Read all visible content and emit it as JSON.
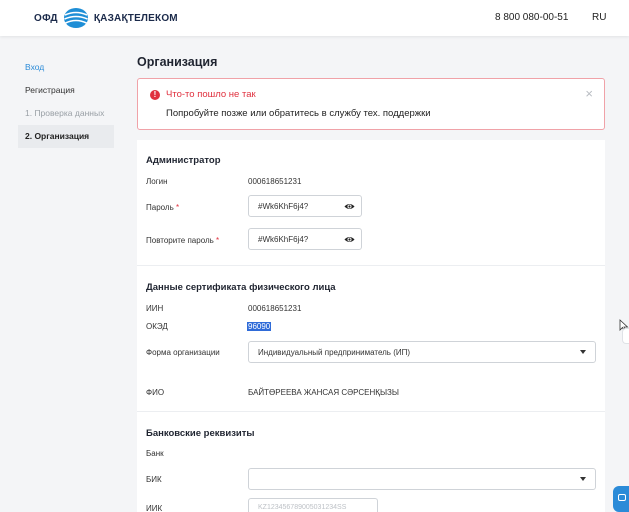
{
  "header": {
    "logo_ofd": "ОФД",
    "logo_brand": "ҚАЗАҚТЕЛЕКОМ",
    "phone": "8 800 080-00-51",
    "lang": "RU"
  },
  "sidebar": {
    "items": [
      {
        "label": "Вход",
        "state": "link"
      },
      {
        "label": "Регистрация",
        "state": "normal"
      },
      {
        "label": "1. Проверка данных",
        "state": "muted"
      },
      {
        "label": "2. Организация",
        "state": "active"
      }
    ]
  },
  "page": {
    "title": "Организация"
  },
  "alert": {
    "title": "Что-то пошло не так",
    "message": "Попробуйте позже или обратитесь в службу тех. поддержки",
    "close": "×"
  },
  "admin": {
    "title": "Администратор",
    "login_label": "Логин",
    "login_value": "000618651231",
    "password_label": "Пароль",
    "password_value": "#Wk6KhF6j4?",
    "repeat_label": "Повторите пароль",
    "repeat_value": "#Wk6KhF6j4?",
    "required_mark": "*"
  },
  "cert": {
    "title": "Данные сертификата физического лица",
    "iin_label": "ИИН",
    "iin_value": "000618651231",
    "okzd_label": "ОКЭД",
    "okzd_value": "96090",
    "form_label": "Форма организации",
    "form_value": "Индивидуальный предприниматель (ИП)",
    "fio_label": "ФИО",
    "fio_value": "БАЙТӨРЕЕВА ЖАНСАЯ СӘРСЕНҚЫЗЫ"
  },
  "bank": {
    "title": "Банковские реквизиты",
    "bank_label": "Банк",
    "bik_label": "БИК",
    "bik_value": "",
    "iik_label": "ИИК",
    "iik_placeholder": "KZ123456789005031234SS"
  },
  "colors": {
    "accent": "#2b8bd8",
    "error": "#e0303e",
    "selection": "#2f6bd8"
  }
}
